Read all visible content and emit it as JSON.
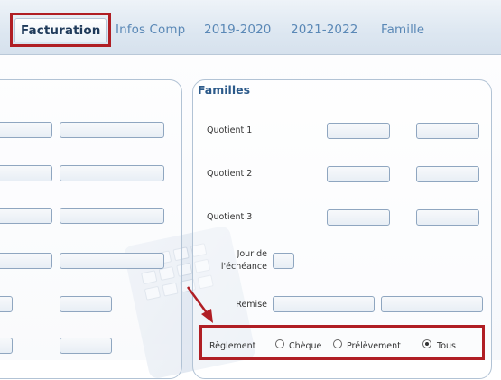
{
  "tabs": [
    {
      "label": "Facturation",
      "active": true
    },
    {
      "label": "Infos Comp",
      "active": false
    },
    {
      "label": "2019-2020",
      "active": false
    },
    {
      "label": "2021-2022",
      "active": false
    },
    {
      "label": "Famille",
      "active": false
    }
  ],
  "familles": {
    "title": "Familles",
    "quotient1_label": "Quotient 1",
    "quotient2_label": "Quotient 2",
    "quotient3_label": "Quotient 3",
    "jour_label_line1": "Jour de",
    "jour_label_line2": "l'échéance",
    "remise_label": "Remise",
    "reglement": {
      "label": "Règlement",
      "options": [
        "Chèque",
        "Prélèvement",
        "Tous"
      ],
      "selected": "Tous"
    }
  },
  "colors": {
    "highlight": "#b01e24",
    "tab_text": "#5a88b6",
    "active_tab_text": "#1f3a5a"
  }
}
